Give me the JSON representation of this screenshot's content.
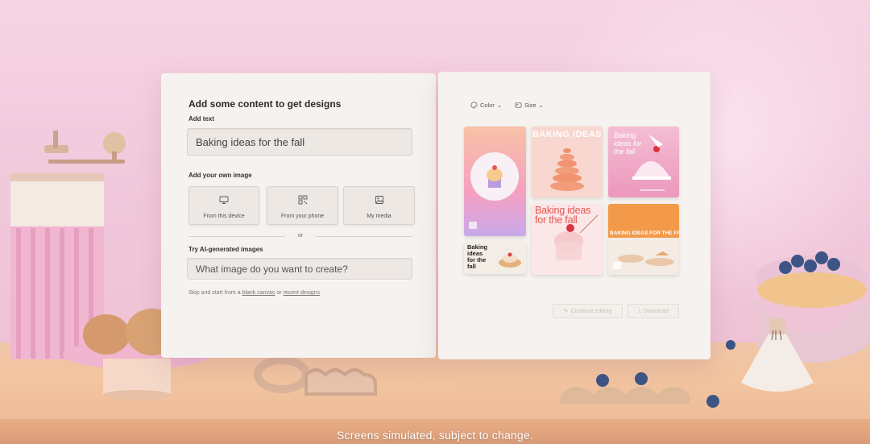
{
  "left_panel": {
    "title": "Add some content to get designs",
    "add_text_label": "Add text",
    "text_input_value": "Baking ideas for the fall",
    "add_image_label": "Add your own image",
    "tiles": [
      {
        "label": "From this device",
        "icon": "monitor-icon"
      },
      {
        "label": "From your phone",
        "icon": "qr-code-icon"
      },
      {
        "label": "My media",
        "icon": "image-icon"
      }
    ],
    "or_label": "or",
    "ai_label": "Try AI-generated images",
    "ai_placeholder": "What image do you want to create?",
    "skip_prefix": "Skip and start from a",
    "skip_blank": "blank canvas",
    "skip_or": "or",
    "skip_recent": "recent designs"
  },
  "right_panel": {
    "color_label": "Color",
    "size_label": "Size",
    "thumb_baking_ideas_title": "BAKING IDEAS",
    "thumb_fall_card_text": "Baking ideas for the fall",
    "thumb_small_card_text": "Baking ideas for the fall",
    "thumb_red_text": "Baking ideas for the fall",
    "thumb_orange_banner": "BAKING IDEAS FOR THE FALL",
    "continue_label": "Continue editing",
    "download_label": "Download"
  },
  "caption": "Screens simulated, subject to change.",
  "colors": {
    "panel_bg": "#f6f2ef",
    "counter": "#f0c6a8",
    "accent_pink": "#f2a6c4",
    "accent_orange": "#f39a4a"
  }
}
